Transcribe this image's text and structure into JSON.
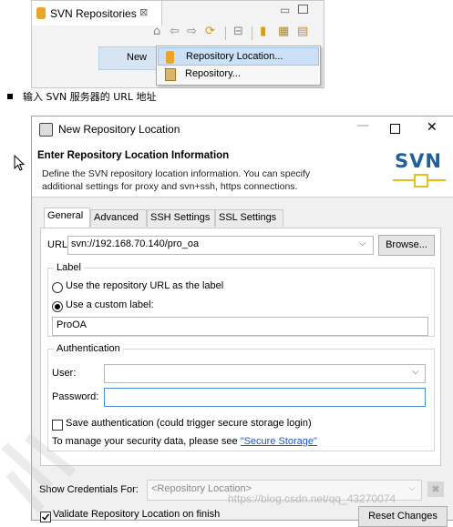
{
  "view": {
    "tab_title": "SVN Repositories",
    "tab_close": "⊠",
    "toolbar_icons": [
      "home-icon",
      "back-icon",
      "forward-icon",
      "refresh-icon",
      "collapse-icon",
      "add-location-icon",
      "svn-import-icon",
      "svn-location-icon"
    ],
    "context_menu": {
      "new_label": "New",
      "new_arrow": ">",
      "submenu": [
        {
          "label": "Repository Location...",
          "icon": "repository-location-icon",
          "highlighted": true
        },
        {
          "label": "Repository...",
          "icon": "repository-icon",
          "highlighted": false
        }
      ]
    }
  },
  "instruction": {
    "text": "输入 SVN 服务器的 URL 地址"
  },
  "dialog": {
    "title": "New Repository Location",
    "window_buttons": {
      "minimize": "—",
      "maximize": "",
      "close": "✕"
    },
    "header_title": "Enter Repository Location Information",
    "header_description": "Define the SVN repository location information. You can specify additional settings for proxy and svn+ssh, https connections.",
    "logo_text": "SVN",
    "tabs": [
      {
        "label": "General",
        "selected": true
      },
      {
        "label": "Advanced",
        "selected": false
      },
      {
        "label": "SSH Settings",
        "selected": false
      },
      {
        "label": "SSL Settings",
        "selected": false
      }
    ],
    "url_label": "URL:",
    "url_value": "svn://192.168.70.140/pro_oa",
    "browse_label": "Browse...",
    "label_group": {
      "legend": "Label",
      "option_repo_url": "Use the repository URL as the label",
      "option_custom": "Use a custom label:",
      "selected": "custom",
      "custom_value": "ProOA"
    },
    "auth_group": {
      "legend": "Authentication",
      "user_label": "User:",
      "user_value": "",
      "password_label": "Password:",
      "password_value": "",
      "save_auth_label": "Save authentication (could trigger secure storage login)",
      "save_auth_checked": false,
      "secure_text": "To manage your security data, please see ",
      "secure_link": "\"Secure Storage\""
    },
    "show_credentials_label": "Show Credentials For:",
    "credentials_value": "<Repository Location>",
    "validate_label": "Validate Repository Location on finish",
    "validate_checked": true,
    "reset_label": "Reset Changes"
  },
  "watermark": "https://blog.csdn.net/qq_43270074",
  "colors": {
    "highlight": "#d6e4f4",
    "link": "#1a55c9",
    "svn_logo": "#1f5f9f",
    "svn_logo_accent": "#e0c020"
  }
}
